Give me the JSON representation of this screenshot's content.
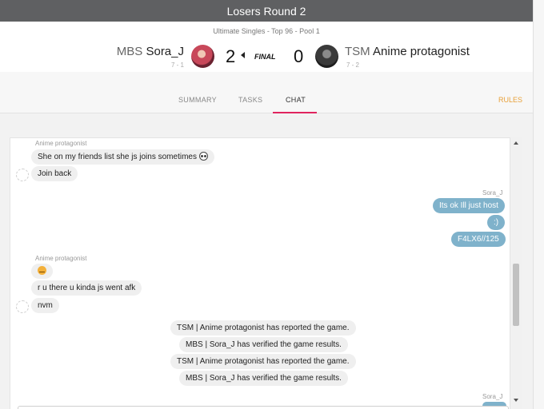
{
  "window": {
    "title": "Losers Round 2"
  },
  "match": {
    "event": "Ultimate Singles - Top 96 - Pool 1",
    "status": "FINAL",
    "player1": {
      "tag": "MBS",
      "name": "Sora_J",
      "record": "7 - 1",
      "score": "2"
    },
    "player2": {
      "tag": "TSM",
      "name": "Anime protagonist",
      "record": "7 - 2",
      "score": "0"
    }
  },
  "tabs": [
    {
      "label": "SUMMARY"
    },
    {
      "label": "TASKS"
    },
    {
      "label": "CHAT",
      "active": true
    }
  ],
  "rules_label": "RULES",
  "chat": {
    "messages": [
      {
        "sender": "Anime protagonist"
      },
      {
        "text": "She on my friends list she js joins sometimes",
        "emoji": "skull-icon"
      },
      {
        "text": "Join back"
      },
      {
        "sender": "Sora_J"
      },
      {
        "text": "Its ok Ill just host"
      },
      {
        "text": ":)"
      },
      {
        "text": "F4LX6//125"
      },
      {
        "sender": "Anime protagonist"
      },
      {
        "emoji": "cat-icon"
      },
      {
        "text": "r u there u kinda js went afk"
      },
      {
        "text": "nvm"
      },
      {
        "text": "TSM | Anime protagonist has reported the game."
      },
      {
        "text": "MBS | Sora_J has verified the game results."
      },
      {
        "text": "TSM | Anime protagonist has reported the game."
      },
      {
        "text": "MBS | Sora_J has verified the game results."
      },
      {
        "sender": "Sora_J"
      }
    ]
  },
  "colors": {
    "accent": "#e0245e",
    "rules": "#e8a13a",
    "outgoing_bubble": "#7fb2cb",
    "titlebar": "#5f6062"
  }
}
